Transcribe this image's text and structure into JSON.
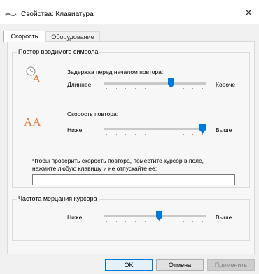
{
  "window": {
    "title": "Свойства: Клавиатура",
    "close_icon": "✕"
  },
  "tabs": [
    {
      "label": "Скорость",
      "active": true
    },
    {
      "label": "Оборудование",
      "active": false
    }
  ],
  "repeat_group": {
    "label": "Повтор вводимого символа",
    "delay": {
      "label": "Задержка перед началом повтора:",
      "left": "Длиннее",
      "right": "Короче",
      "position": 0.67
    },
    "rate": {
      "label": "Скорость повтора:",
      "left": "Ниже",
      "right": "Выше",
      "position": 1.0
    },
    "test_label_line1": "Чтобы проверить скорость повтора, поместите курсор в поле,",
    "test_label_line2": "нажмите любую клавишу и не отпускайте ее:",
    "test_value": ""
  },
  "blink_group": {
    "label": "Частота мерцания курсора",
    "left": "Ниже",
    "right": "Выше",
    "position": 0.55
  },
  "buttons": {
    "ok": "OK",
    "cancel": "Отмена",
    "apply": "Применить"
  },
  "colors": {
    "accent": "#0078d7",
    "delay_icon": "#e07b39",
    "rate_icon": "#e07b39"
  }
}
